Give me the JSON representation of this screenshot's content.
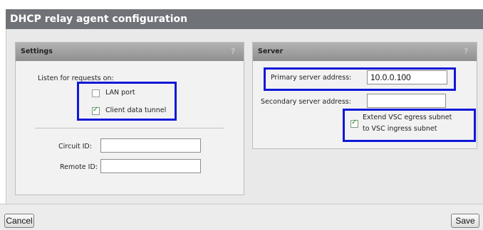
{
  "page": {
    "title": "DHCP relay agent configuration"
  },
  "settings": {
    "title": "Settings",
    "help": "?",
    "listen_label": "Listen for requests on:",
    "lan_port": {
      "label": "LAN port",
      "checked": false
    },
    "client_data_tunnel": {
      "label": "Client data tunnel",
      "checked": true
    },
    "circuit_id": {
      "label": "Circuit ID:",
      "value": ""
    },
    "remote_id": {
      "label": "Remote ID:",
      "value": ""
    }
  },
  "server": {
    "title": "Server",
    "help": "?",
    "primary": {
      "label": "Primary server address:",
      "value": "10.0.0.100"
    },
    "secondary": {
      "label": "Secondary server address:",
      "value": ""
    },
    "extend_vsc": {
      "line1": "Extend VSC egress subnet",
      "line2": "to VSC ingress subnet",
      "checked": true
    }
  },
  "actions": {
    "cancel": "Cancel",
    "save": "Save"
  },
  "colors": {
    "highlight": "#1018d8",
    "titlebar": "#6f7277",
    "panel_header": "#a0a0a0"
  }
}
